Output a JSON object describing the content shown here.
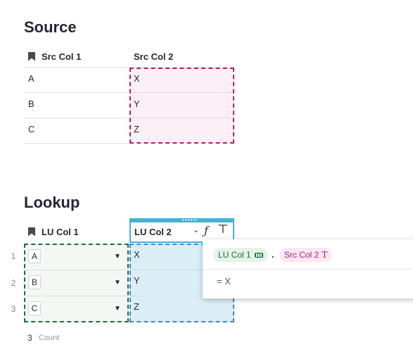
{
  "source": {
    "title": "Source",
    "columns": [
      "Src Col 1",
      "Src Col 2"
    ],
    "rows": [
      {
        "col1": "A",
        "col2": "X"
      },
      {
        "col1": "B",
        "col2": "Y"
      },
      {
        "col1": "C",
        "col2": "Z"
      }
    ]
  },
  "lookup": {
    "title": "Lookup",
    "columns": [
      "LU Col 1",
      "LU Col 2"
    ],
    "rows": [
      {
        "num": "1",
        "col1": "A",
        "col2": "X"
      },
      {
        "num": "2",
        "col1": "B",
        "col2": "Y"
      },
      {
        "num": "3",
        "col1": "C",
        "col2": "Z"
      }
    ],
    "footer": {
      "count": "3",
      "label": "Count"
    }
  },
  "formula": {
    "token1": "LU Col 1",
    "separator": ".",
    "token2": "Src Col 2",
    "token2_icon": "T",
    "result": "=  X"
  },
  "icons": {
    "column_header_ref": "bookmark-icon",
    "type_formula": "function-icon",
    "type_text": "text-type-icon"
  },
  "colors": {
    "source_highlight": "#b21b7a",
    "lookup_ref_highlight": "#16733b",
    "lookup_result_highlight": "#3b86d3",
    "active_column": "#45b1d4"
  }
}
